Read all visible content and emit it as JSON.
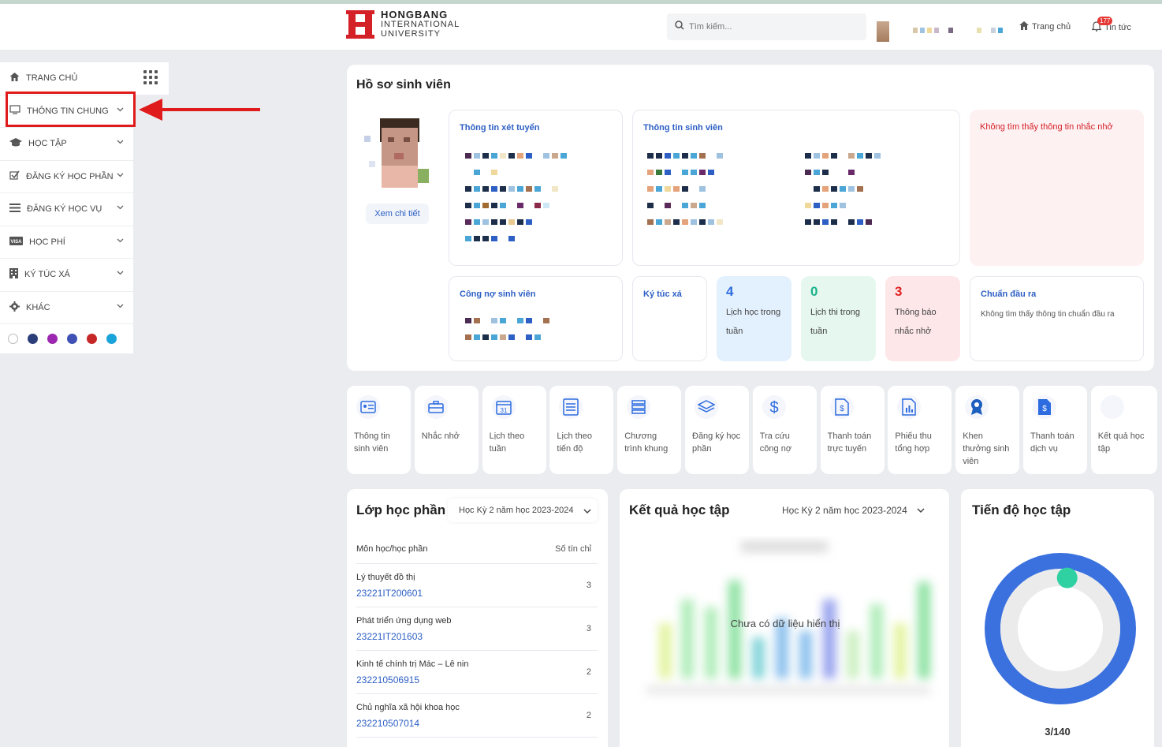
{
  "header": {
    "logo_line1": "HONGBANG",
    "logo_line2": "INTERNATIONAL",
    "logo_line3": "UNIVERSITY",
    "search_placeholder": "Tìm kiếm...",
    "nav_home": "Trang chủ",
    "nav_news": "Tin tức",
    "notification_count": "177"
  },
  "sidebar": {
    "items": [
      {
        "label": "TRANG CHỦ",
        "icon": "home-icon"
      },
      {
        "label": "THÔNG TIN CHUNG",
        "icon": "monitor-icon"
      },
      {
        "label": "HỌC TẬP",
        "icon": "graduation-cap-icon"
      },
      {
        "label": "ĐĂNG KÝ HỌC PHẦN",
        "icon": "check-square-icon"
      },
      {
        "label": "ĐĂNG KÝ HỌC VỤ",
        "icon": "list-icon"
      },
      {
        "label": "HỌC PHÍ",
        "icon": "visa-card-icon"
      },
      {
        "label": "KÝ TÚC XÁ",
        "icon": "building-icon"
      },
      {
        "label": "KHÁC",
        "icon": "gear-icon"
      }
    ],
    "theme_colors": [
      "#ffffff",
      "#2c3e7a",
      "#9c27b0",
      "#3f51b5",
      "#c62828",
      "#1aa3d9"
    ]
  },
  "profile": {
    "title": "Hồ sơ sinh viên",
    "view_detail": "Xem chi tiết",
    "admission_title": "Thông tin xét tuyển",
    "student_info_title": "Thông tin sinh viên",
    "reminder_empty": "Không tìm thấy thông tin nhắc nhở",
    "debt_title": "Công nợ sinh viên",
    "dorm_title": "Ký túc xá",
    "stats": [
      {
        "num": "4",
        "label_1": "Lịch học trong",
        "label_2": "tuần",
        "color": "#2d6ce0",
        "bg": "#e3f0fd"
      },
      {
        "num": "0",
        "label_1": "Lịch thi trong",
        "label_2": "tuần",
        "color": "#1bb38a",
        "bg": "#e5f7ee"
      },
      {
        "num": "3",
        "label_1": "Thông báo",
        "label_2": "nhắc nhở",
        "color": "#e02424",
        "bg": "#fde7e9"
      }
    ],
    "output_title": "Chuẩn đầu ra",
    "output_empty": "Không tìm thấy thông tin chuẩn đầu ra"
  },
  "quick_actions": [
    {
      "line1": "Thông tin",
      "line2": "sinh viên",
      "line3": "",
      "icon": "id-card-icon"
    },
    {
      "line1": "Nhắc nhở",
      "line2": "",
      "line3": "",
      "icon": "briefcase-icon"
    },
    {
      "line1": "Lịch theo",
      "line2": "tuần",
      "line3": "",
      "icon": "calendar-icon"
    },
    {
      "line1": "Lịch theo",
      "line2": "tiến độ",
      "line3": "",
      "icon": "list-doc-icon"
    },
    {
      "line1": "Chương",
      "line2": "trình khung",
      "line3": "",
      "icon": "stack-icon"
    },
    {
      "line1": "Đăng ký học",
      "line2": "phần",
      "line3": "",
      "icon": "layers-icon"
    },
    {
      "line1": "Tra cứu",
      "line2": "công nợ",
      "line3": "",
      "icon": "dollar-icon"
    },
    {
      "line1": "Thanh toán",
      "line2": "trực tuyến",
      "line3": "",
      "icon": "invoice-icon"
    },
    {
      "line1": "Phiếu thu",
      "line2": "tổng hợp",
      "line3": "",
      "icon": "chart-doc-icon"
    },
    {
      "line1": "Khen",
      "line2": "thưởng sinh",
      "line3": "viên",
      "icon": "award-icon"
    },
    {
      "line1": "Thanh toán",
      "line2": "dịch vụ",
      "line3": "",
      "icon": "service-invoice-icon"
    },
    {
      "line1": "Kết quả học",
      "line2": "tập",
      "line3": "",
      "icon": "result-icon"
    }
  ],
  "classes": {
    "title": "Lớp học phần",
    "semester": "Học Kỳ 2 năm học 2023-2024",
    "col_subject": "Môn học/học phần",
    "col_credits": "Số tín chỉ",
    "rows": [
      {
        "name": "Lý thuyết đồ thị",
        "code": "23221IT200601",
        "credits": "3"
      },
      {
        "name": "Phát triển ứng dụng web",
        "code": "23221IT201603",
        "credits": "3"
      },
      {
        "name": "Kinh tế chính trị Mác – Lê nin",
        "code": "232210506915",
        "credits": "2"
      },
      {
        "name": "Chủ nghĩa xã hội khoa học",
        "code": "232210507014",
        "credits": "2"
      }
    ]
  },
  "results": {
    "title": "Kết quả học tập",
    "semester": "Học Kỳ 2 năm học 2023-2024",
    "empty": "Chưa có dữ liệu hiển thị"
  },
  "progress": {
    "title": "Tiến độ học tập",
    "value": "3/140",
    "fraction": 0.0214
  }
}
